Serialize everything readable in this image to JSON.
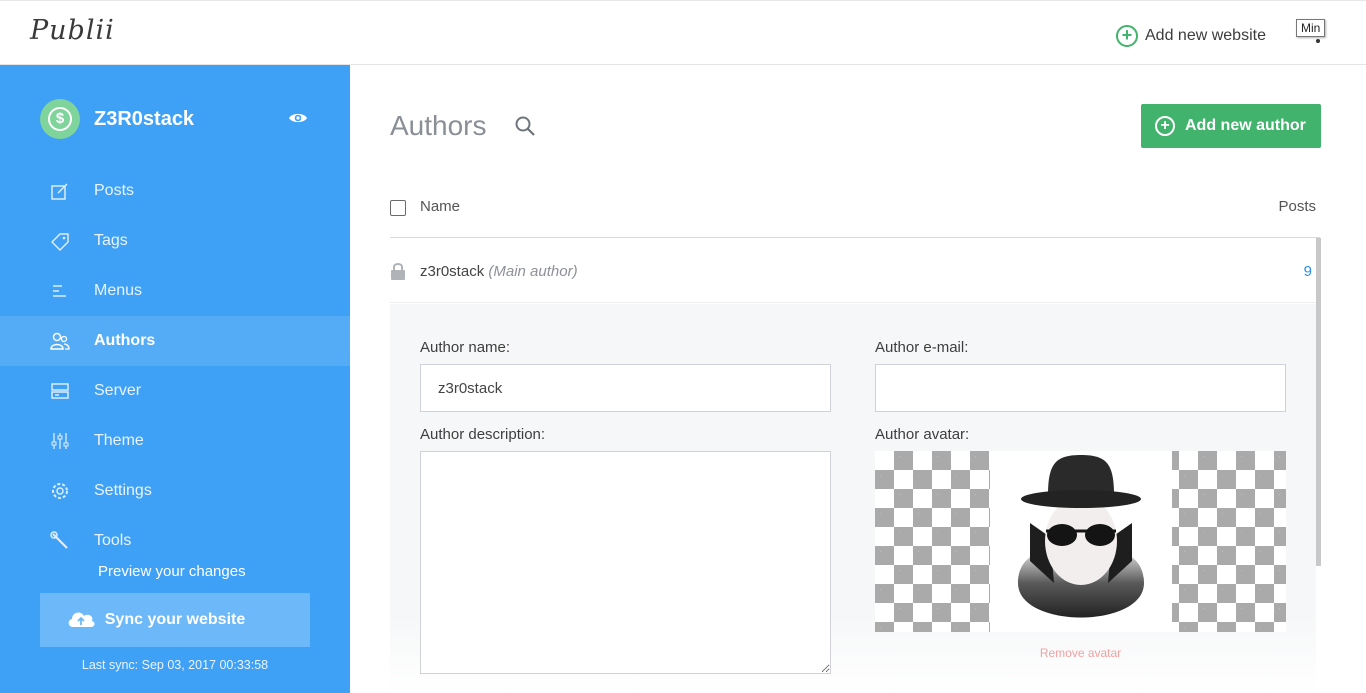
{
  "app": {
    "logo": "Publii",
    "min_tooltip": "Min"
  },
  "topbar": {
    "add_website_label": "Add new website"
  },
  "sidebar": {
    "site_name": "Z3R0stack",
    "items": [
      {
        "label": "Posts",
        "icon": "edit-icon"
      },
      {
        "label": "Tags",
        "icon": "tag-icon"
      },
      {
        "label": "Menus",
        "icon": "menu-icon"
      },
      {
        "label": "Authors",
        "icon": "users-icon",
        "active": true
      },
      {
        "label": "Server",
        "icon": "server-icon"
      },
      {
        "label": "Theme",
        "icon": "sliders-icon"
      },
      {
        "label": "Settings",
        "icon": "gear-icon"
      },
      {
        "label": "Tools",
        "icon": "wrench-icon"
      }
    ],
    "preview_label": "Preview your changes",
    "sync_label": "Sync your website",
    "last_sync": "Last sync: Sep 03, 2017 00:33:58"
  },
  "main": {
    "title": "Authors",
    "add_author_label": "Add new author",
    "table": {
      "col_name": "Name",
      "col_posts": "Posts",
      "rows": [
        {
          "name": "z3r0stack",
          "tag": "(Main author)",
          "posts": "9"
        }
      ]
    },
    "form": {
      "name_label": "Author name:",
      "name_value": "z3r0stack",
      "email_label": "Author e-mail:",
      "email_value": "",
      "description_label": "Author description:",
      "avatar_label": "Author avatar:",
      "remove_avatar_label": "Remove avatar"
    }
  },
  "colors": {
    "sidebar": "#3fa1f5",
    "accent_green": "#41b36c",
    "link_blue": "#2a8fe8"
  }
}
